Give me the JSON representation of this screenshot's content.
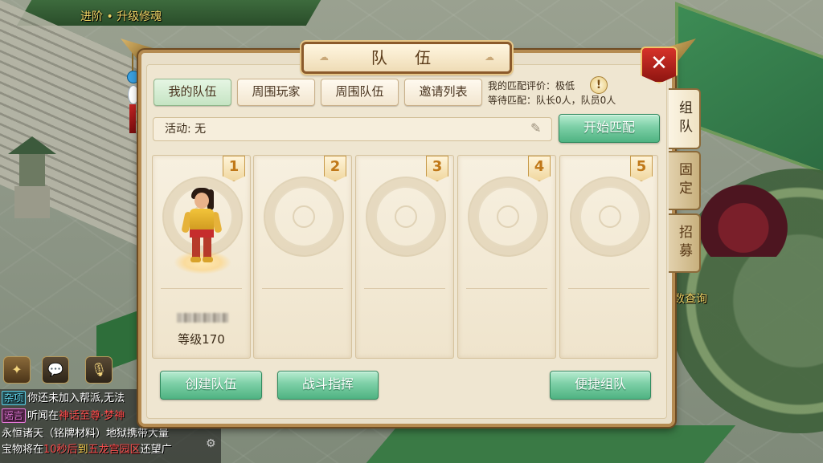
{
  "world": {
    "quest_text": "进阶 • 升级修魂",
    "dungeon_label": "数查询"
  },
  "panel": {
    "title": "队 伍",
    "close_icon": "✕"
  },
  "tabs": [
    {
      "label": "我的队伍",
      "active": true
    },
    {
      "label": "周围玩家",
      "active": false
    },
    {
      "label": "周围队伍",
      "active": false
    },
    {
      "label": "邀请列表",
      "active": false
    }
  ],
  "match_info": {
    "rating": "我的匹配评价：极低",
    "waiting": "等待匹配：队长0人，队员0人",
    "info_icon": "!"
  },
  "activity": {
    "text": "活动: 无",
    "edit_icon": "✎"
  },
  "start_match_label": "开始匹配",
  "side_tabs": [
    {
      "label": "组队",
      "active": true
    },
    {
      "label": "固定",
      "active": false
    },
    {
      "label": "招募",
      "active": false
    }
  ],
  "slots": [
    {
      "number": "1",
      "occupied": true,
      "level": "等级170"
    },
    {
      "number": "2",
      "occupied": false
    },
    {
      "number": "3",
      "occupied": false
    },
    {
      "number": "4",
      "occupied": false
    },
    {
      "number": "5",
      "occupied": false
    }
  ],
  "bottom_buttons": {
    "create": "创建队伍",
    "command": "战斗指挥",
    "quick": "便捷组队"
  },
  "chat": {
    "icons": [
      "emoji-icon",
      "voice-icon"
    ],
    "lines": [
      {
        "tag": "杂项",
        "tag_type": "misc",
        "text": "你还未加入帮派,无法"
      },
      {
        "tag": "谣言",
        "tag_type": "rumor",
        "text": "听闻在",
        "hl": "神话至尊·梦神",
        "text2": ""
      },
      {
        "tag": "",
        "tag_type": "",
        "text": "永恒诸天（铭牌材料）地狱携带大量"
      },
      {
        "tag": "",
        "tag_type": "",
        "text": "宝物将在",
        "hl": "10秒后",
        "text2": "到",
        "hl2": "五龙宫园区",
        "text3": "还望广"
      }
    ]
  },
  "colors": {
    "accent_green": "#4fb382",
    "panel_bg": "#efe6d1",
    "frame_brown": "#b58b51",
    "close_red": "#d6322a"
  }
}
